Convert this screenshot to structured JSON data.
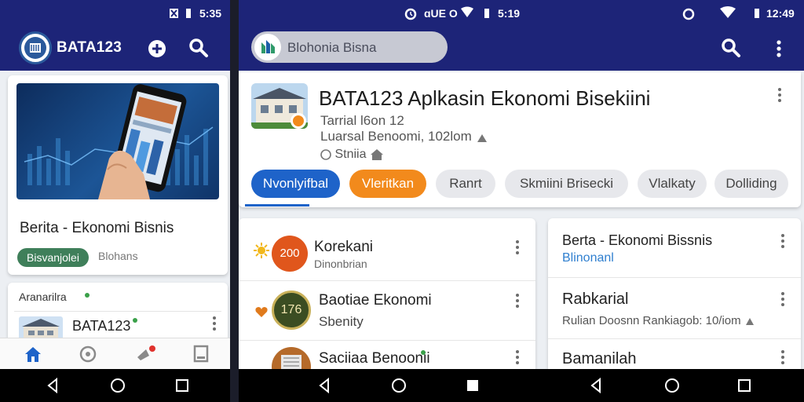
{
  "left": {
    "status": {
      "time": "5:35"
    },
    "appbar": {
      "title": "BATA123"
    },
    "card": {
      "title": "Berita - Ekonomi Bisnis",
      "tag": "Bisvanjolei",
      "tag_secondary": "Blohans"
    },
    "section": {
      "title": "Aranarilra"
    },
    "list_item": {
      "title": "BATA123"
    },
    "colors": {
      "primary": "#1d2478",
      "tag_green": "#3f7f5a",
      "nav_active": "#1e63c9",
      "badge_red": "#e0322d"
    }
  },
  "right": {
    "status": {
      "time_center": "5:19",
      "time_right": "12:49",
      "center_label": "ɑUE O"
    },
    "search": {
      "placeholder": "Blohonia Bisna"
    },
    "header": {
      "title": "BATA123 Aplkasin Ekonomi Bisekiini",
      "subtitle": "Tarrial  l6on 12",
      "meta": "Luarsal Benoomi, 102lom",
      "meta2": "Stniia"
    },
    "chips": [
      "Nvonlyifbal",
      "Vleritkan",
      "Ranrt",
      "Skmiini Brisecki",
      "Vlalkaty",
      "Dolliding"
    ],
    "left_list": [
      {
        "title": "Korekani",
        "subtitle": "Dinonbrian",
        "badge": "200"
      },
      {
        "title": "Baotiae Ekonomi",
        "subtitle": "Sbenity",
        "badge": "176"
      },
      {
        "title": "Saciiaa Benoonii",
        "subtitle": ""
      }
    ],
    "right_list": [
      {
        "title": "Berta - Ekonomi Bissnis",
        "subtitle": "Blinonanl"
      },
      {
        "title": "Rabkarial",
        "subtitle": "Rulian Doosnn Rankiagob: 10/iom"
      },
      {
        "title": "Bamanilah",
        "subtitle": ""
      }
    ],
    "colors": {
      "chip_blue": "#1e63c9",
      "chip_orange": "#f28a1c",
      "chip_grey": "#e7e8ec",
      "link_blue": "#2f7fcf"
    }
  }
}
